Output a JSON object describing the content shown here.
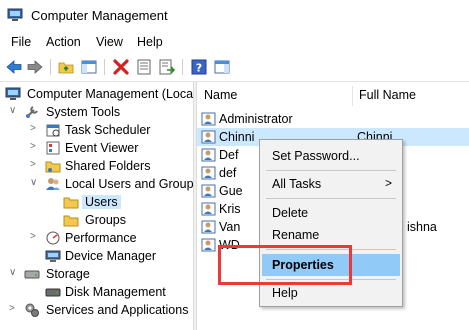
{
  "window": {
    "title": "Computer Management"
  },
  "menu": [
    "File",
    "Action",
    "View",
    "Help"
  ],
  "toolbar": {
    "buttons": [
      "back-arrow-icon",
      "forward-arrow-icon",
      "up-folder-icon",
      "show-hide-tree-icon",
      "delete-icon",
      "properties-icon",
      "export-list-icon",
      "help-icon",
      "action-pane-icon"
    ]
  },
  "tree": {
    "root": "Computer Management (Local",
    "system_tools": "System Tools",
    "task_scheduler": "Task Scheduler",
    "event_viewer": "Event Viewer",
    "shared_folders": "Shared Folders",
    "local_users_groups": "Local Users and Groups",
    "users": "Users",
    "groups": "Groups",
    "performance": "Performance",
    "device_manager": "Device Manager",
    "storage": "Storage",
    "disk_management": "Disk Management",
    "services_apps": "Services and Applications"
  },
  "list": {
    "headers": {
      "name": "Name",
      "full_name": "Full Name"
    },
    "rows": [
      {
        "name": "Administrator",
        "full": ""
      },
      {
        "name": "Chinni",
        "full": "Chinni"
      },
      {
        "name": "Def",
        "full": ""
      },
      {
        "name": "def",
        "full": ""
      },
      {
        "name": "Gue",
        "full": ""
      },
      {
        "name": "Kris",
        "full": ""
      },
      {
        "name": "Van",
        "full": "ishna"
      },
      {
        "name": "WD",
        "full": ""
      }
    ]
  },
  "context_menu": {
    "set_password": "Set Password...",
    "all_tasks": "All Tasks",
    "all_tasks_arrow": ">",
    "delete": "Delete",
    "rename": "Rename",
    "properties": "Properties",
    "help": "Help"
  },
  "colors": {
    "selection": "#cce8ff",
    "menu_hover": "#91c9f7",
    "annotation": "#e83a3a"
  }
}
